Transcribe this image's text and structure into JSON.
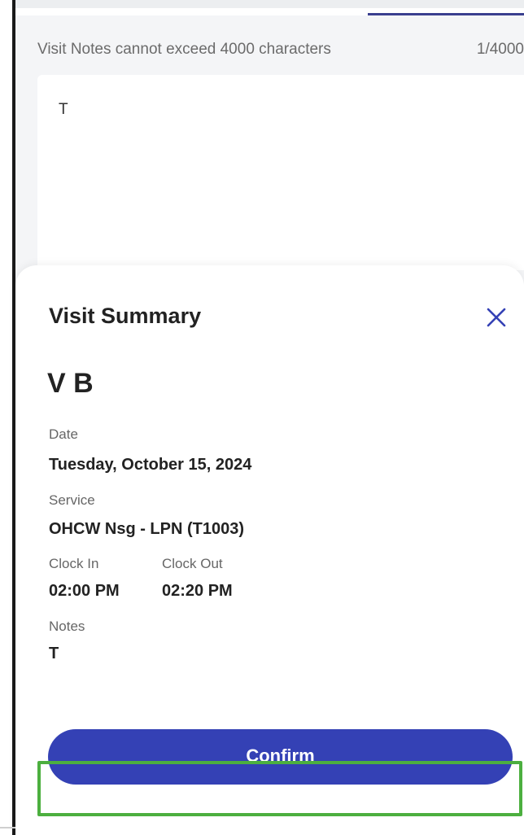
{
  "notes_editor": {
    "hint": "Visit Notes cannot exceed 4000 characters",
    "counter": "1/4000",
    "text": "T"
  },
  "summary": {
    "title": "Visit Summary",
    "client_name": "V B",
    "date_label": "Date",
    "date_value": "Tuesday, October 15, 2024",
    "service_label": "Service",
    "service_value": "OHCW Nsg - LPN (T1003)",
    "clock_in_label": "Clock In",
    "clock_in_value": "02:00 PM",
    "clock_out_label": "Clock Out",
    "clock_out_value": "02:20 PM",
    "notes_label": "Notes",
    "notes_value": "T",
    "confirm_label": "Confirm"
  },
  "icons": {
    "close": "close-icon"
  },
  "colors": {
    "accent": "#3441b5",
    "highlight": "#4caf3f",
    "close_icon": "#3441b5"
  }
}
